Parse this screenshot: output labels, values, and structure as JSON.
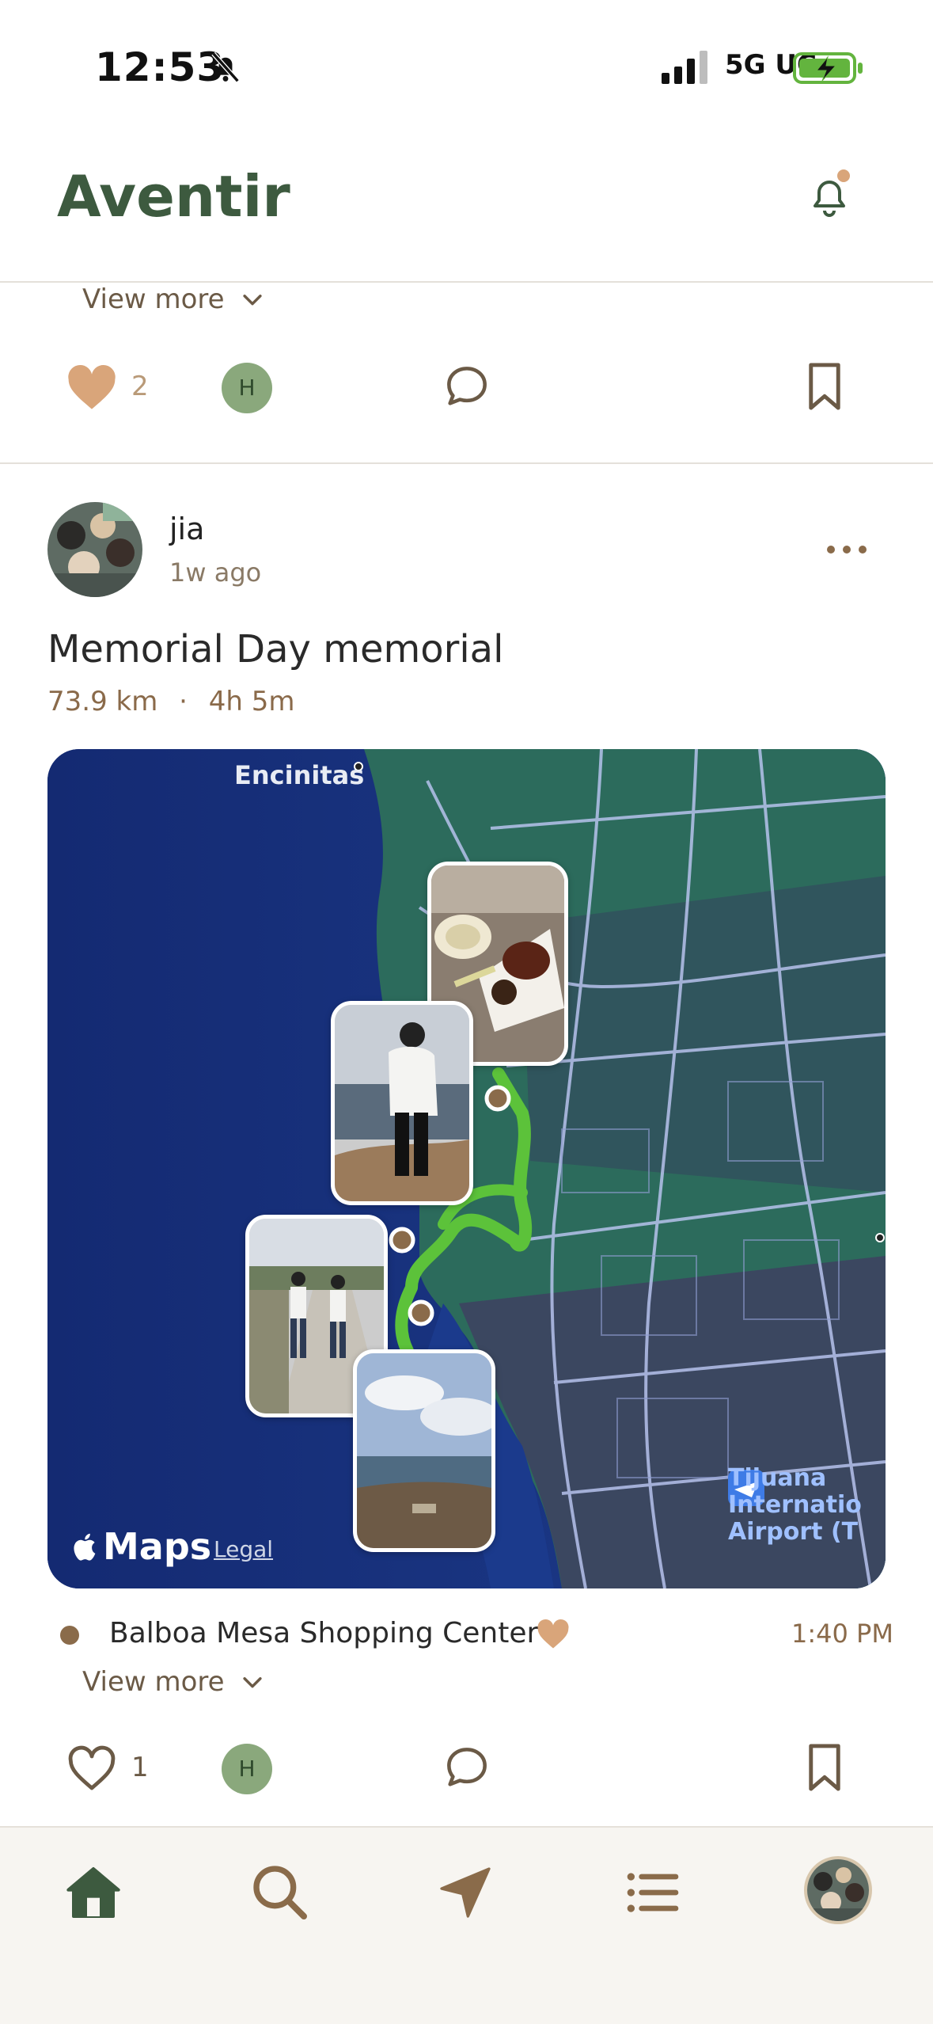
{
  "status_bar": {
    "time": "12:53",
    "network": "5G UC"
  },
  "header": {
    "brand": "Aventir"
  },
  "prev_post": {
    "view_more": "View more",
    "like_count": "2",
    "liker_initial": "H"
  },
  "post": {
    "username": "jia",
    "time_ago": "1w ago",
    "title": "Memorial Day memorial",
    "distance": "73.9 km",
    "separator": "·",
    "duration": "4h 5m",
    "map": {
      "town_label": "Encinitas",
      "provider_label": "Maps",
      "legal_label": "Legal",
      "airport_label_lines": [
        "Tijuana",
        "Internatio",
        "Airport (T"
      ],
      "route_color": "#5cc23a"
    },
    "stop": {
      "name": "Balboa Mesa Shopping Center",
      "time": "1:40 PM"
    },
    "view_more": "View more",
    "like_count": "1",
    "liker_initial": "H"
  },
  "nav": {
    "items": [
      "home-icon",
      "search-icon",
      "navigate-icon",
      "list-icon",
      "profile-avatar"
    ]
  },
  "colors": {
    "brand_green": "#3d5a3f",
    "accent_tan": "#d9a57a",
    "brown": "#8a6b4a"
  }
}
